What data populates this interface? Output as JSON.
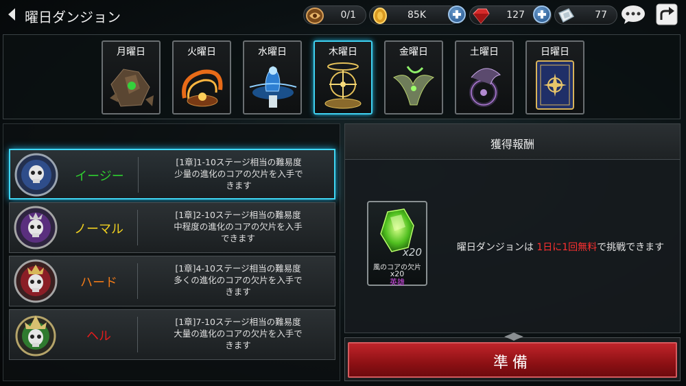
{
  "header": {
    "title": "曜日ダンジョン"
  },
  "resources": [
    {
      "name": "stamina-ticket-icon",
      "value": "0/1"
    },
    {
      "name": "gold-coin-icon",
      "value": "85K"
    },
    {
      "name": "ruby-icon",
      "value": "127"
    },
    {
      "name": "crystal-ticket-icon",
      "value": "77"
    }
  ],
  "day_tabs": [
    {
      "label": "月曜日",
      "active": false
    },
    {
      "label": "火曜日",
      "active": false
    },
    {
      "label": "水曜日",
      "active": false
    },
    {
      "label": "木曜日",
      "active": true
    },
    {
      "label": "金曜日",
      "active": false
    },
    {
      "label": "土曜日",
      "active": false
    },
    {
      "label": "日曜日",
      "active": false
    }
  ],
  "difficulties": [
    {
      "name": "イージー",
      "color": "#2fd02f",
      "active": true,
      "desc": [
        "[1章]1-10ステージ相当の難易度",
        "少量の進化のコアの欠片を入手で",
        "きます"
      ]
    },
    {
      "name": "ノーマル",
      "color": "#f0d020",
      "active": false,
      "desc": [
        "[1章]2-10ステージ相当の難易度",
        "中程度の進化のコアの欠片を入手",
        "できます"
      ]
    },
    {
      "name": "ハード",
      "color": "#f07a18",
      "active": false,
      "desc": [
        "[1章]4-10ステージ相当の難易度",
        "多くの進化のコアの欠片を入手で",
        "きます"
      ]
    },
    {
      "name": "ヘル",
      "color": "#e51c1c",
      "active": false,
      "desc": [
        "[1章]7-10ステージ相当の難易度",
        "大量の進化のコアの欠片を入手で",
        "きます"
      ]
    }
  ],
  "reward": {
    "title": "獲得報酬",
    "item_name": "風のコアの欠片",
    "quantity_big": "x20",
    "quantity": "x20",
    "rarity": "英雄",
    "note_prefix": "曜日ダンジョンは",
    "note_highlight": "1日に1回無料",
    "note_suffix": "で挑戦できます"
  },
  "ready_button": {
    "label": "準備"
  },
  "colors": {
    "active_border": "#3fd2f2",
    "ready_button": "#a0181d",
    "highlight_red": "#ff3030",
    "rarity_purple": "#d34de8"
  }
}
